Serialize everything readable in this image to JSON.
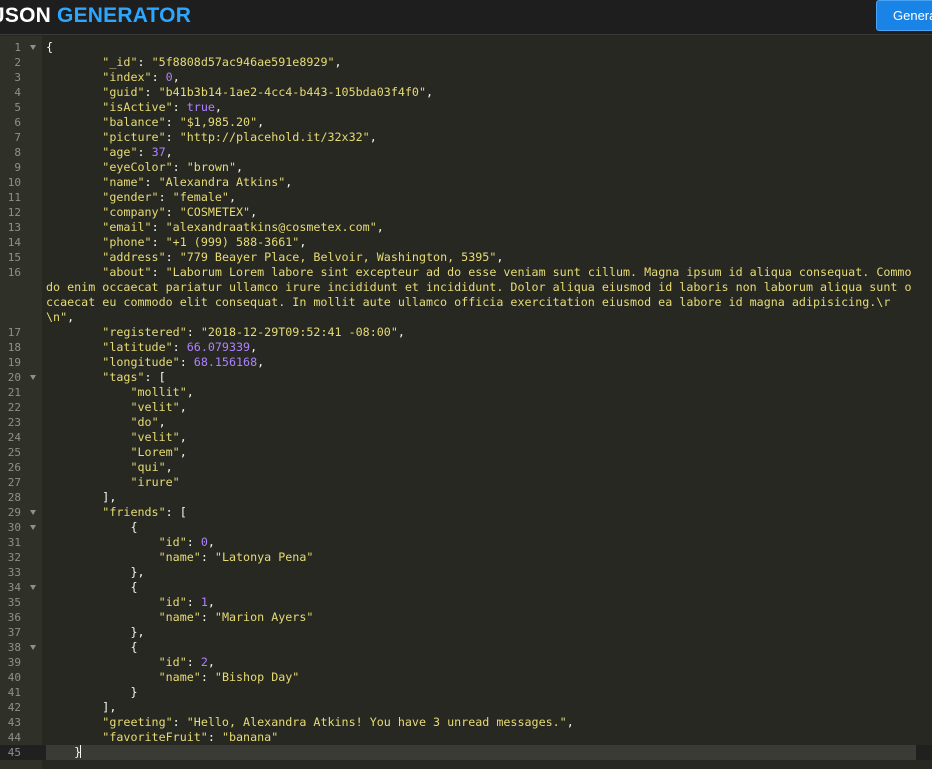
{
  "header": {
    "logo_part1": "JSON",
    "logo_part2": " GENERATOR",
    "generate_button": "Genera"
  },
  "colors": {
    "background": "#272822",
    "gutter": "#2f3129",
    "key_string": "#e6db74",
    "number_boolean": "#ae81ff",
    "punctuation": "#f8f8f2",
    "accent": "#2da6ff",
    "button": "#1a83e6"
  },
  "editor": {
    "lines": [
      {
        "num": "1",
        "fold": true,
        "tokens": [
          [
            "p",
            "{"
          ]
        ]
      },
      {
        "num": "2",
        "tokens": [
          [
            "p",
            "        "
          ],
          [
            "k",
            "\"_id\""
          ],
          [
            "p",
            ": "
          ],
          [
            "s",
            "\"5f8808d57ac946ae591e8929\""
          ],
          [
            "p",
            ","
          ]
        ]
      },
      {
        "num": "3",
        "tokens": [
          [
            "p",
            "        "
          ],
          [
            "k",
            "\"index\""
          ],
          [
            "p",
            ": "
          ],
          [
            "n",
            "0"
          ],
          [
            "p",
            ","
          ]
        ]
      },
      {
        "num": "4",
        "tokens": [
          [
            "p",
            "        "
          ],
          [
            "k",
            "\"guid\""
          ],
          [
            "p",
            ": "
          ],
          [
            "s",
            "\"b41b3b14-1ae2-4cc4-b443-105bda03f4f0\""
          ],
          [
            "p",
            ","
          ]
        ]
      },
      {
        "num": "5",
        "tokens": [
          [
            "p",
            "        "
          ],
          [
            "k",
            "\"isActive\""
          ],
          [
            "p",
            ": "
          ],
          [
            "b",
            "true"
          ],
          [
            "p",
            ","
          ]
        ]
      },
      {
        "num": "6",
        "tokens": [
          [
            "p",
            "        "
          ],
          [
            "k",
            "\"balance\""
          ],
          [
            "p",
            ": "
          ],
          [
            "s",
            "\"$1,985.20\""
          ],
          [
            "p",
            ","
          ]
        ]
      },
      {
        "num": "7",
        "tokens": [
          [
            "p",
            "        "
          ],
          [
            "k",
            "\"picture\""
          ],
          [
            "p",
            ": "
          ],
          [
            "s",
            "\"http://placehold.it/32x32\""
          ],
          [
            "p",
            ","
          ]
        ]
      },
      {
        "num": "8",
        "tokens": [
          [
            "p",
            "        "
          ],
          [
            "k",
            "\"age\""
          ],
          [
            "p",
            ": "
          ],
          [
            "n",
            "37"
          ],
          [
            "p",
            ","
          ]
        ]
      },
      {
        "num": "9",
        "tokens": [
          [
            "p",
            "        "
          ],
          [
            "k",
            "\"eyeColor\""
          ],
          [
            "p",
            ": "
          ],
          [
            "s",
            "\"brown\""
          ],
          [
            "p",
            ","
          ]
        ]
      },
      {
        "num": "10",
        "tokens": [
          [
            "p",
            "        "
          ],
          [
            "k",
            "\"name\""
          ],
          [
            "p",
            ": "
          ],
          [
            "s",
            "\"Alexandra Atkins\""
          ],
          [
            "p",
            ","
          ]
        ]
      },
      {
        "num": "11",
        "tokens": [
          [
            "p",
            "        "
          ],
          [
            "k",
            "\"gender\""
          ],
          [
            "p",
            ": "
          ],
          [
            "s",
            "\"female\""
          ],
          [
            "p",
            ","
          ]
        ]
      },
      {
        "num": "12",
        "tokens": [
          [
            "p",
            "        "
          ],
          [
            "k",
            "\"company\""
          ],
          [
            "p",
            ": "
          ],
          [
            "s",
            "\"COSMETEX\""
          ],
          [
            "p",
            ","
          ]
        ]
      },
      {
        "num": "13",
        "tokens": [
          [
            "p",
            "        "
          ],
          [
            "k",
            "\"email\""
          ],
          [
            "p",
            ": "
          ],
          [
            "s",
            "\"alexandraatkins@cosmetex.com\""
          ],
          [
            "p",
            ","
          ]
        ]
      },
      {
        "num": "14",
        "tokens": [
          [
            "p",
            "        "
          ],
          [
            "k",
            "\"phone\""
          ],
          [
            "p",
            ": "
          ],
          [
            "s",
            "\"+1 (999) 588-3661\""
          ],
          [
            "p",
            ","
          ]
        ]
      },
      {
        "num": "15",
        "tokens": [
          [
            "p",
            "        "
          ],
          [
            "k",
            "\"address\""
          ],
          [
            "p",
            ": "
          ],
          [
            "s",
            "\"779 Beayer Place, Belvoir, Washington, 5395\""
          ],
          [
            "p",
            ","
          ]
        ]
      },
      {
        "num": "16",
        "tokens": [
          [
            "p",
            "        "
          ],
          [
            "k",
            "\"about\""
          ],
          [
            "p",
            ": "
          ],
          [
            "s",
            "\"Laborum Lorem labore sint excepteur ad do esse veniam sunt cillum. Magna ipsum id aliqua consequat. Commodo enim occaecat pariatur ullamco irure incididunt et incididunt. Dolor aliqua eiusmod id laboris non laborum aliqua sunt occaecat eu commodo elit consequat. In mollit aute ullamco officia exercitation eiusmod ea labore id magna adipisicing.\\r\\n\""
          ],
          [
            "p",
            ","
          ]
        ]
      },
      {
        "num": "17",
        "tokens": [
          [
            "p",
            "        "
          ],
          [
            "k",
            "\"registered\""
          ],
          [
            "p",
            ": "
          ],
          [
            "s",
            "\"2018-12-29T09:52:41 -08:00\""
          ],
          [
            "p",
            ","
          ]
        ]
      },
      {
        "num": "18",
        "tokens": [
          [
            "p",
            "        "
          ],
          [
            "k",
            "\"latitude\""
          ],
          [
            "p",
            ": "
          ],
          [
            "n",
            "66.079339"
          ],
          [
            "p",
            ","
          ]
        ]
      },
      {
        "num": "19",
        "tokens": [
          [
            "p",
            "        "
          ],
          [
            "k",
            "\"longitude\""
          ],
          [
            "p",
            ": "
          ],
          [
            "n",
            "68.156168"
          ],
          [
            "p",
            ","
          ]
        ]
      },
      {
        "num": "20",
        "fold": true,
        "tokens": [
          [
            "p",
            "        "
          ],
          [
            "k",
            "\"tags\""
          ],
          [
            "p",
            ": ["
          ]
        ]
      },
      {
        "num": "21",
        "tokens": [
          [
            "p",
            "            "
          ],
          [
            "s",
            "\"mollit\""
          ],
          [
            "p",
            ","
          ]
        ]
      },
      {
        "num": "22",
        "tokens": [
          [
            "p",
            "            "
          ],
          [
            "s",
            "\"velit\""
          ],
          [
            "p",
            ","
          ]
        ]
      },
      {
        "num": "23",
        "tokens": [
          [
            "p",
            "            "
          ],
          [
            "s",
            "\"do\""
          ],
          [
            "p",
            ","
          ]
        ]
      },
      {
        "num": "24",
        "tokens": [
          [
            "p",
            "            "
          ],
          [
            "s",
            "\"velit\""
          ],
          [
            "p",
            ","
          ]
        ]
      },
      {
        "num": "25",
        "tokens": [
          [
            "p",
            "            "
          ],
          [
            "s",
            "\"Lorem\""
          ],
          [
            "p",
            ","
          ]
        ]
      },
      {
        "num": "26",
        "tokens": [
          [
            "p",
            "            "
          ],
          [
            "s",
            "\"qui\""
          ],
          [
            "p",
            ","
          ]
        ]
      },
      {
        "num": "27",
        "tokens": [
          [
            "p",
            "            "
          ],
          [
            "s",
            "\"irure\""
          ]
        ]
      },
      {
        "num": "28",
        "tokens": [
          [
            "p",
            "        ],"
          ]
        ]
      },
      {
        "num": "29",
        "fold": true,
        "tokens": [
          [
            "p",
            "        "
          ],
          [
            "k",
            "\"friends\""
          ],
          [
            "p",
            ": ["
          ]
        ]
      },
      {
        "num": "30",
        "fold": true,
        "tokens": [
          [
            "p",
            "            {"
          ]
        ]
      },
      {
        "num": "31",
        "tokens": [
          [
            "p",
            "                "
          ],
          [
            "k",
            "\"id\""
          ],
          [
            "p",
            ": "
          ],
          [
            "n",
            "0"
          ],
          [
            "p",
            ","
          ]
        ]
      },
      {
        "num": "32",
        "tokens": [
          [
            "p",
            "                "
          ],
          [
            "k",
            "\"name\""
          ],
          [
            "p",
            ": "
          ],
          [
            "s",
            "\"Latonya Pena\""
          ]
        ]
      },
      {
        "num": "33",
        "tokens": [
          [
            "p",
            "            },"
          ]
        ]
      },
      {
        "num": "34",
        "fold": true,
        "tokens": [
          [
            "p",
            "            {"
          ]
        ]
      },
      {
        "num": "35",
        "tokens": [
          [
            "p",
            "                "
          ],
          [
            "k",
            "\"id\""
          ],
          [
            "p",
            ": "
          ],
          [
            "n",
            "1"
          ],
          [
            "p",
            ","
          ]
        ]
      },
      {
        "num": "36",
        "tokens": [
          [
            "p",
            "                "
          ],
          [
            "k",
            "\"name\""
          ],
          [
            "p",
            ": "
          ],
          [
            "s",
            "\"Marion Ayers\""
          ]
        ]
      },
      {
        "num": "37",
        "tokens": [
          [
            "p",
            "            },"
          ]
        ]
      },
      {
        "num": "38",
        "fold": true,
        "tokens": [
          [
            "p",
            "            {"
          ]
        ]
      },
      {
        "num": "39",
        "tokens": [
          [
            "p",
            "                "
          ],
          [
            "k",
            "\"id\""
          ],
          [
            "p",
            ": "
          ],
          [
            "n",
            "2"
          ],
          [
            "p",
            ","
          ]
        ]
      },
      {
        "num": "40",
        "tokens": [
          [
            "p",
            "                "
          ],
          [
            "k",
            "\"name\""
          ],
          [
            "p",
            ": "
          ],
          [
            "s",
            "\"Bishop Day\""
          ]
        ]
      },
      {
        "num": "41",
        "tokens": [
          [
            "p",
            "            }"
          ]
        ]
      },
      {
        "num": "42",
        "tokens": [
          [
            "p",
            "        ],"
          ]
        ]
      },
      {
        "num": "43",
        "tokens": [
          [
            "p",
            "        "
          ],
          [
            "k",
            "\"greeting\""
          ],
          [
            "p",
            ": "
          ],
          [
            "s",
            "\"Hello, Alexandra Atkins! You have 3 unread messages.\""
          ],
          [
            "p",
            ","
          ]
        ]
      },
      {
        "num": "44",
        "tokens": [
          [
            "p",
            "        "
          ],
          [
            "k",
            "\"favoriteFruit\""
          ],
          [
            "p",
            ": "
          ],
          [
            "s",
            "\"banana\""
          ]
        ]
      },
      {
        "num": "45",
        "active": true,
        "cursor": true,
        "tokens": [
          [
            "p",
            "    }"
          ]
        ]
      }
    ]
  }
}
